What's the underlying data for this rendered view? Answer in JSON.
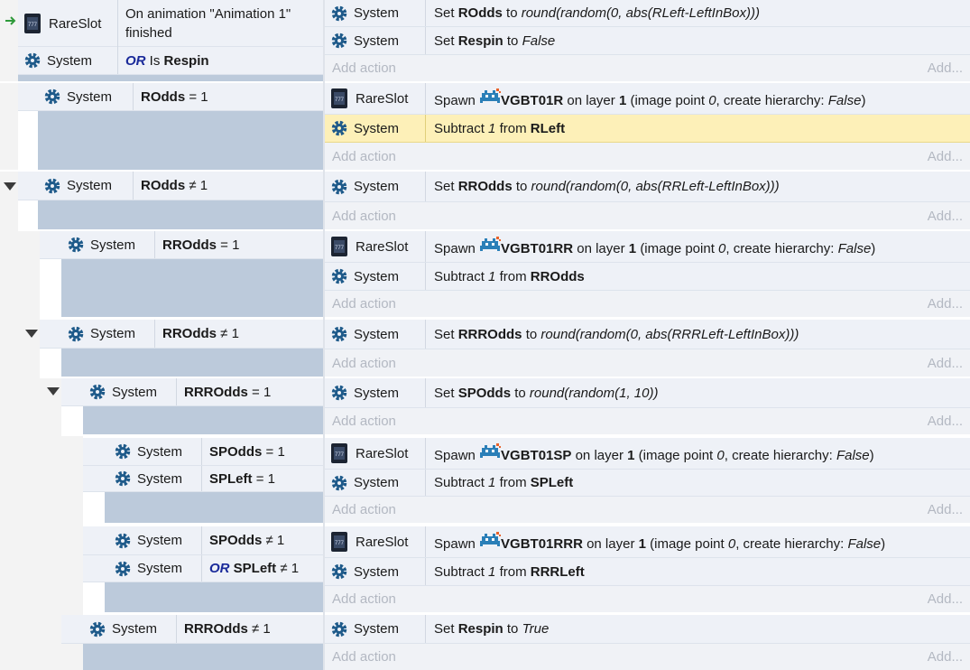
{
  "labels": {
    "system": "System",
    "rareslot": "RareSlot",
    "add_action": "Add action",
    "add_more": "Add...",
    "or": "OR",
    "on_layer": "on layer",
    "image_point": "(image point",
    "create_hierarchy": "create hierarchy:",
    "spawn": "Spawn",
    "set": "Set",
    "to": "to",
    "subtract": "Subtract",
    "from": "from",
    "is": "Is"
  },
  "event1": {
    "cond1": "On animation \"Animation 1\" finished",
    "cond2_var": "Respin",
    "a1": {
      "var": "ROdds",
      "expr": "round(random(0, abs(RLeft-LeftInBox)))"
    },
    "a2": {
      "var": "Respin",
      "value": "False"
    }
  },
  "event2": {
    "cond": {
      "var": "ROdds",
      "op": "= 1"
    },
    "a1": {
      "sprite": "VGBT01R",
      "layer": "1",
      "point": "0",
      "hier": "False"
    },
    "a2": {
      "amount": "1",
      "var": "RLeft"
    }
  },
  "event3": {
    "cond": {
      "var": "ROdds",
      "op": "≠ 1"
    },
    "a1": {
      "var": "RROdds",
      "expr": "round(random(0, abs(RRLeft-LeftInBox)))"
    }
  },
  "event4": {
    "cond": {
      "var": "RROdds",
      "op": "= 1"
    },
    "a1": {
      "sprite": "VGBT01RR",
      "layer": "1",
      "point": "0",
      "hier": "False"
    },
    "a2": {
      "amount": "1",
      "var": "RROdds"
    }
  },
  "event5": {
    "cond": {
      "var": "RROdds",
      "op": "≠ 1"
    },
    "a1": {
      "var": "RRROdds",
      "expr": "round(random(0, abs(RRRLeft-LeftInBox)))"
    }
  },
  "event6": {
    "cond": {
      "var": "RRROdds",
      "op": "= 1"
    },
    "a1": {
      "var": "SPOdds",
      "expr": "round(random(1, 10))"
    }
  },
  "event7": {
    "cond1": {
      "var": "SPOdds",
      "op": "= 1"
    },
    "cond2": {
      "var": "SPLeft",
      "op": "= 1"
    },
    "a1": {
      "sprite": "VGBT01SP",
      "layer": "1",
      "point": "0",
      "hier": "False"
    },
    "a2": {
      "amount": "1",
      "var": "SPLeft"
    }
  },
  "event8": {
    "cond1": {
      "var": "SPOdds",
      "op": "≠ 1"
    },
    "cond2": {
      "var": "SPLeft",
      "op": "≠ 1"
    },
    "a1": {
      "sprite": "VGBT01RRR",
      "layer": "1",
      "point": "0",
      "hier": "False"
    },
    "a2": {
      "amount": "1",
      "var": "RRRLeft"
    }
  },
  "event9": {
    "cond": {
      "var": "RRROdds",
      "op": "≠ 1"
    },
    "a1": {
      "var": "Respin",
      "value": "True"
    }
  },
  "colors": {
    "event_blue": "#bccadb",
    "row_bg": "#eef1f7",
    "selected": "#fdf0b8",
    "or_blue": "#1a2a9a",
    "gear_blue": "#1e5a8a",
    "trigger_green": "#2e9a3a"
  },
  "icons": [
    "trigger-arrow-icon",
    "rareslot-sprite-icon",
    "system-gear-icon",
    "invader-sprite-icon",
    "collapse-triangle-icon"
  ]
}
